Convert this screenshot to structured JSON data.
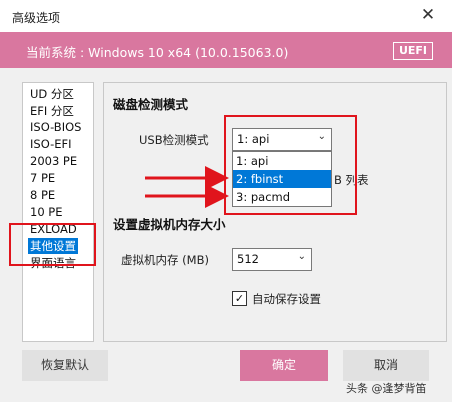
{
  "window": {
    "title": "高级选项",
    "close": "✕"
  },
  "banner": {
    "system_text": "当前系统 : Windows 10 x64 (10.0.15063.0)",
    "badge": "UEFI"
  },
  "nav": {
    "items": [
      "UD 分区",
      "EFI 分区",
      "ISO-BIOS",
      "ISO-EFI",
      "2003 PE",
      "7 PE",
      "8 PE",
      "10 PE",
      "EXLOAD",
      "其他设置",
      "界面语言"
    ],
    "selected_index": 9
  },
  "disk": {
    "heading": "磁盘检测模式",
    "usb_label": "USB检测模式",
    "usb_value": "1: api",
    "options": [
      "1: api",
      "2: fbinst",
      "3: pacmd"
    ],
    "highlighted_option": 1,
    "hidden_text": "B 列表"
  },
  "vm": {
    "heading": "设置虚拟机内存大小",
    "mem_label": "虚拟机内存 (MB)",
    "mem_value": "512",
    "autosave_label": "自动保存设置",
    "autosave_checked": true
  },
  "buttons": {
    "restore": "恢复默认",
    "ok": "确定",
    "cancel": "取消"
  },
  "watermark": "头条 @逢梦背笛",
  "colors": {
    "accent": "#d9779f",
    "select_blue": "#0078d7",
    "annotation_red": "#e0141c"
  },
  "icons": {
    "chevron": "chevron-down-icon",
    "check": "check-icon",
    "arrow": "red-arrow"
  }
}
